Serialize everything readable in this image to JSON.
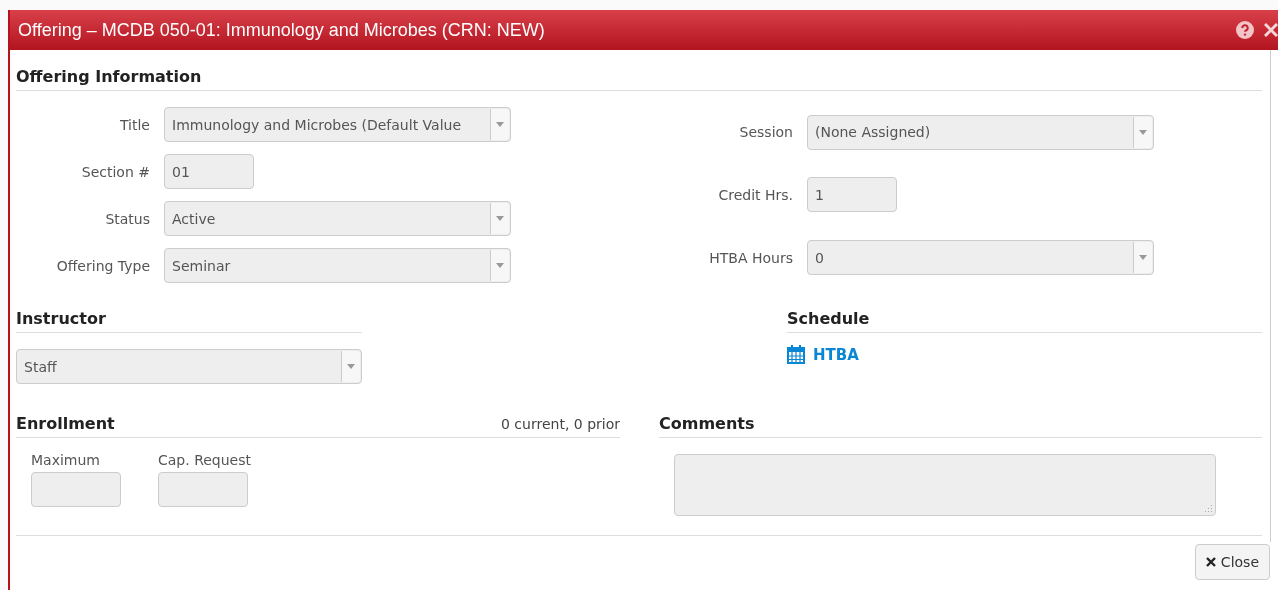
{
  "dialog": {
    "title": "Offering – MCDB 050-01: Immunology and Microbes (CRN: NEW)"
  },
  "offering_information": {
    "heading": "Offering Information",
    "left_fields": [
      {
        "label": "Title",
        "value": "Immunology and Microbes (Default Value",
        "kind": "select",
        "disabled": true
      },
      {
        "label": "Section #",
        "value": "01",
        "kind": "text",
        "disabled": true
      },
      {
        "label": "Status",
        "value": "Active",
        "kind": "select",
        "disabled": true
      },
      {
        "label": "Offering Type",
        "value": "Seminar",
        "kind": "select",
        "disabled": true
      }
    ],
    "right_fields": [
      {
        "label": "Session",
        "value": "(None Assigned)",
        "kind": "select",
        "disabled": true
      },
      {
        "label": "Credit Hrs.",
        "value": "1",
        "kind": "text",
        "disabled": true
      },
      {
        "label": "HTBA Hours",
        "value": "0",
        "kind": "select",
        "disabled": true
      }
    ]
  },
  "instructor": {
    "heading": "Instructor",
    "value": "Staff",
    "disabled": true
  },
  "schedule": {
    "heading": "Schedule",
    "link": "HTBA"
  },
  "enrollment": {
    "heading": "Enrollment",
    "summary": "0 current, 0 prior",
    "fields": [
      {
        "label": "Maximum",
        "disabled": true
      },
      {
        "label": "Cap. Request",
        "disabled": true
      }
    ]
  },
  "comments": {
    "heading": "Comments",
    "disabled": true
  },
  "footer": {
    "close_button": "Close"
  }
}
